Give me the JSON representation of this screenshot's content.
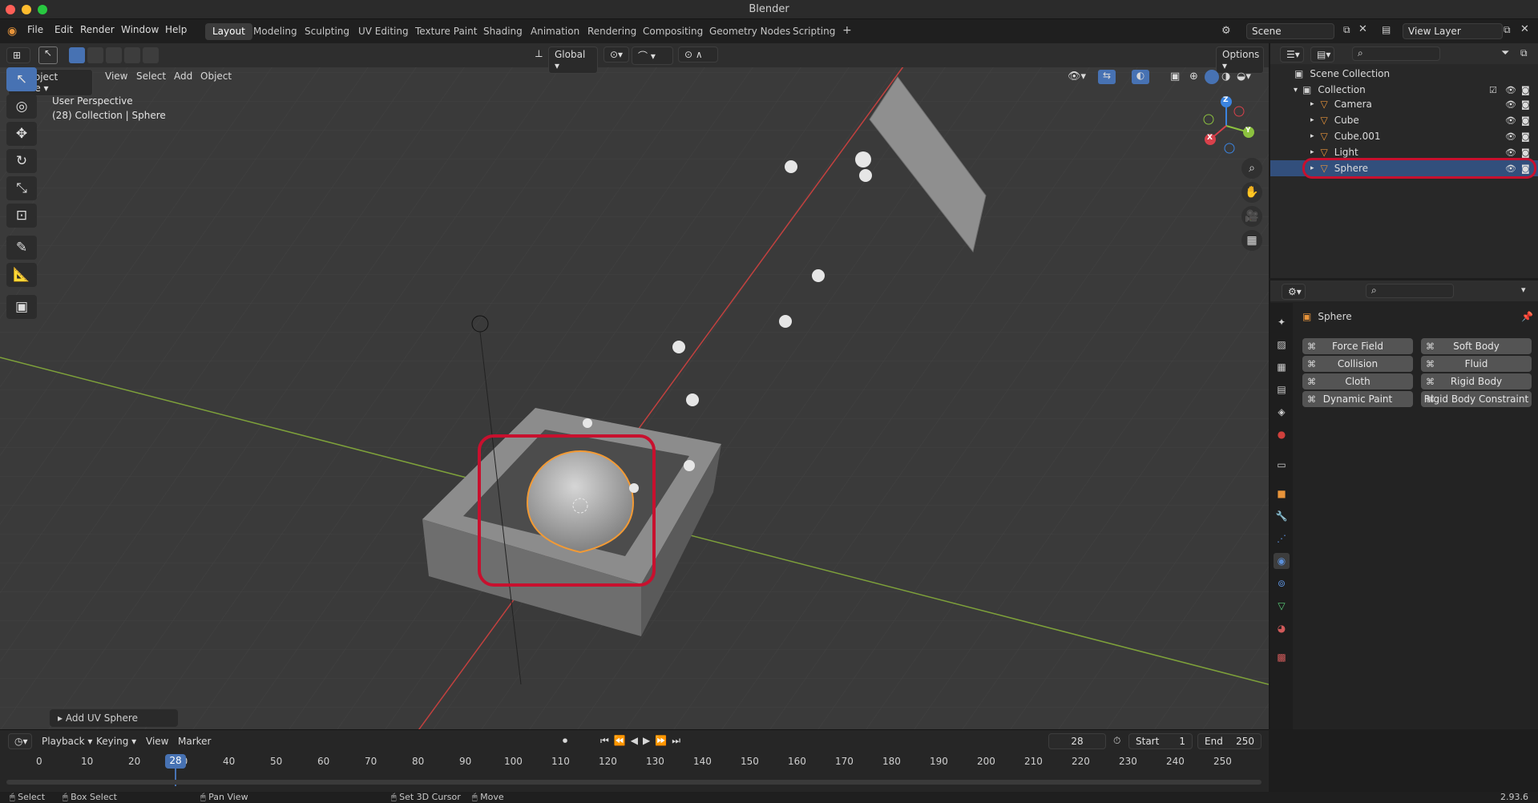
{
  "window": {
    "title": "Blender"
  },
  "topbar": {
    "menu": [
      "File",
      "Edit",
      "Render",
      "Window",
      "Help"
    ],
    "workspaces": [
      "Layout",
      "Modeling",
      "Sculpting",
      "UV Editing",
      "Texture Paint",
      "Shading",
      "Animation",
      "Rendering",
      "Compositing",
      "Geometry Nodes",
      "Scripting"
    ],
    "active_workspace": "Layout",
    "add_tab": "+",
    "scene": "Scene",
    "view_layer": "View Layer"
  },
  "viewport": {
    "mode": "Object Mode",
    "menus": [
      "View",
      "Select",
      "Add",
      "Object"
    ],
    "orientation": "Global",
    "options_label": "Options",
    "overlay_line1": "User Perspective",
    "overlay_line2": "(28) Collection | Sphere",
    "last_op": "Add UV Sphere",
    "gizmo": {
      "x": "X",
      "y": "Y",
      "z": "Z"
    }
  },
  "outliner": {
    "root": "Scene Collection",
    "collection": "Collection",
    "items": [
      {
        "name": "Camera",
        "icon": "camera-icon",
        "color": "#e8943a"
      },
      {
        "name": "Cube",
        "icon": "mesh-icon",
        "color": "#e8943a"
      },
      {
        "name": "Cube.001",
        "icon": "mesh-icon",
        "color": "#e8943a"
      },
      {
        "name": "Light",
        "icon": "light-icon",
        "color": "#e8943a"
      },
      {
        "name": "Sphere",
        "icon": "mesh-icon",
        "color": "#e8943a",
        "selected": true
      }
    ]
  },
  "properties": {
    "object_name": "Sphere",
    "physics_buttons": [
      {
        "label": "Force Field",
        "icon": "force-field-icon"
      },
      {
        "label": "Soft Body",
        "icon": "soft-body-icon"
      },
      {
        "label": "Collision",
        "icon": "collision-icon"
      },
      {
        "label": "Fluid",
        "icon": "fluid-icon"
      },
      {
        "label": "Cloth",
        "icon": "cloth-icon"
      },
      {
        "label": "Rigid Body",
        "icon": "rigid-body-icon"
      },
      {
        "label": "Dynamic Paint",
        "icon": "dynamic-paint-icon"
      },
      {
        "label": "Rigid Body Constraint",
        "icon": "rigid-body-constraint-icon"
      }
    ]
  },
  "timeline": {
    "menus": [
      "Playback",
      "Keying",
      "View",
      "Marker"
    ],
    "current_frame": "28",
    "start_label": "Start",
    "start_value": "1",
    "end_label": "End",
    "end_value": "250",
    "ticks": [
      "0",
      "10",
      "20",
      "30",
      "40",
      "50",
      "60",
      "70",
      "80",
      "90",
      "100",
      "110",
      "120",
      "130",
      "140",
      "150",
      "160",
      "170",
      "180",
      "190",
      "200",
      "210",
      "220",
      "230",
      "240",
      "250"
    ]
  },
  "statusbar": {
    "select": "Select",
    "box_select": "Box Select",
    "pan_view": "Pan View",
    "set_cursor": "Set 3D Cursor",
    "move": "Move",
    "version": "2.93.6"
  },
  "colors": {
    "accent": "#4772b3",
    "highlight_red": "#c8102e",
    "selection_orange": "#f29a35",
    "x_axis": "#d9414b",
    "y_axis": "#8cc13f",
    "z_axis": "#3b84e0"
  }
}
